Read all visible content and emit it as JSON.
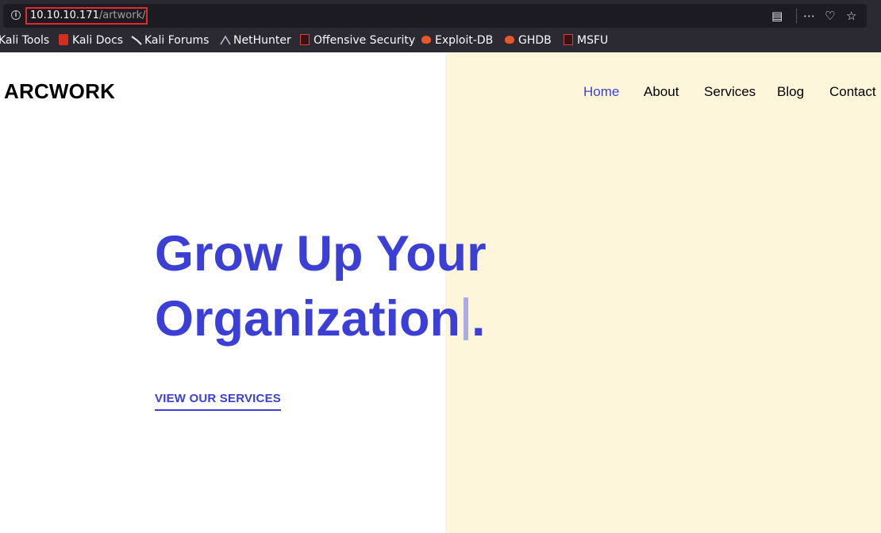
{
  "browser": {
    "url_host": "10.10.10.171",
    "url_path": "/artwork/",
    "icons": [
      "info-icon",
      "reader-view-icon",
      "more-actions-icon",
      "pocket-icon",
      "bookmark-star-icon"
    ],
    "bookmarks": [
      {
        "label": "Kali Tools",
        "icon": "kali-tools-icon"
      },
      {
        "label": "Kali Docs",
        "icon": "kali-docs-icon"
      },
      {
        "label": "Kali Forums",
        "icon": "kali-forums-icon"
      },
      {
        "label": "NetHunter",
        "icon": "nethunter-icon"
      },
      {
        "label": "Offensive Security",
        "icon": "offsec-icon"
      },
      {
        "label": "Exploit-DB",
        "icon": "exploitdb-icon"
      },
      {
        "label": "GHDB",
        "icon": "ghdb-icon"
      },
      {
        "label": "MSFU",
        "icon": "msfu-icon"
      }
    ]
  },
  "site": {
    "logo": "ARCWORK",
    "nav": [
      "Home",
      "About",
      "Services",
      "Blog",
      "Contact"
    ],
    "active_nav": "Home",
    "hero_line1": "Grow Up Your",
    "hero_line2": "Organization",
    "hero_suffix": ".",
    "cta": "VIEW OUR SERVICES"
  },
  "colors": {
    "accent": "#3b3fd6",
    "panel": "#fef6da",
    "url_highlight": "#e02b2b"
  }
}
